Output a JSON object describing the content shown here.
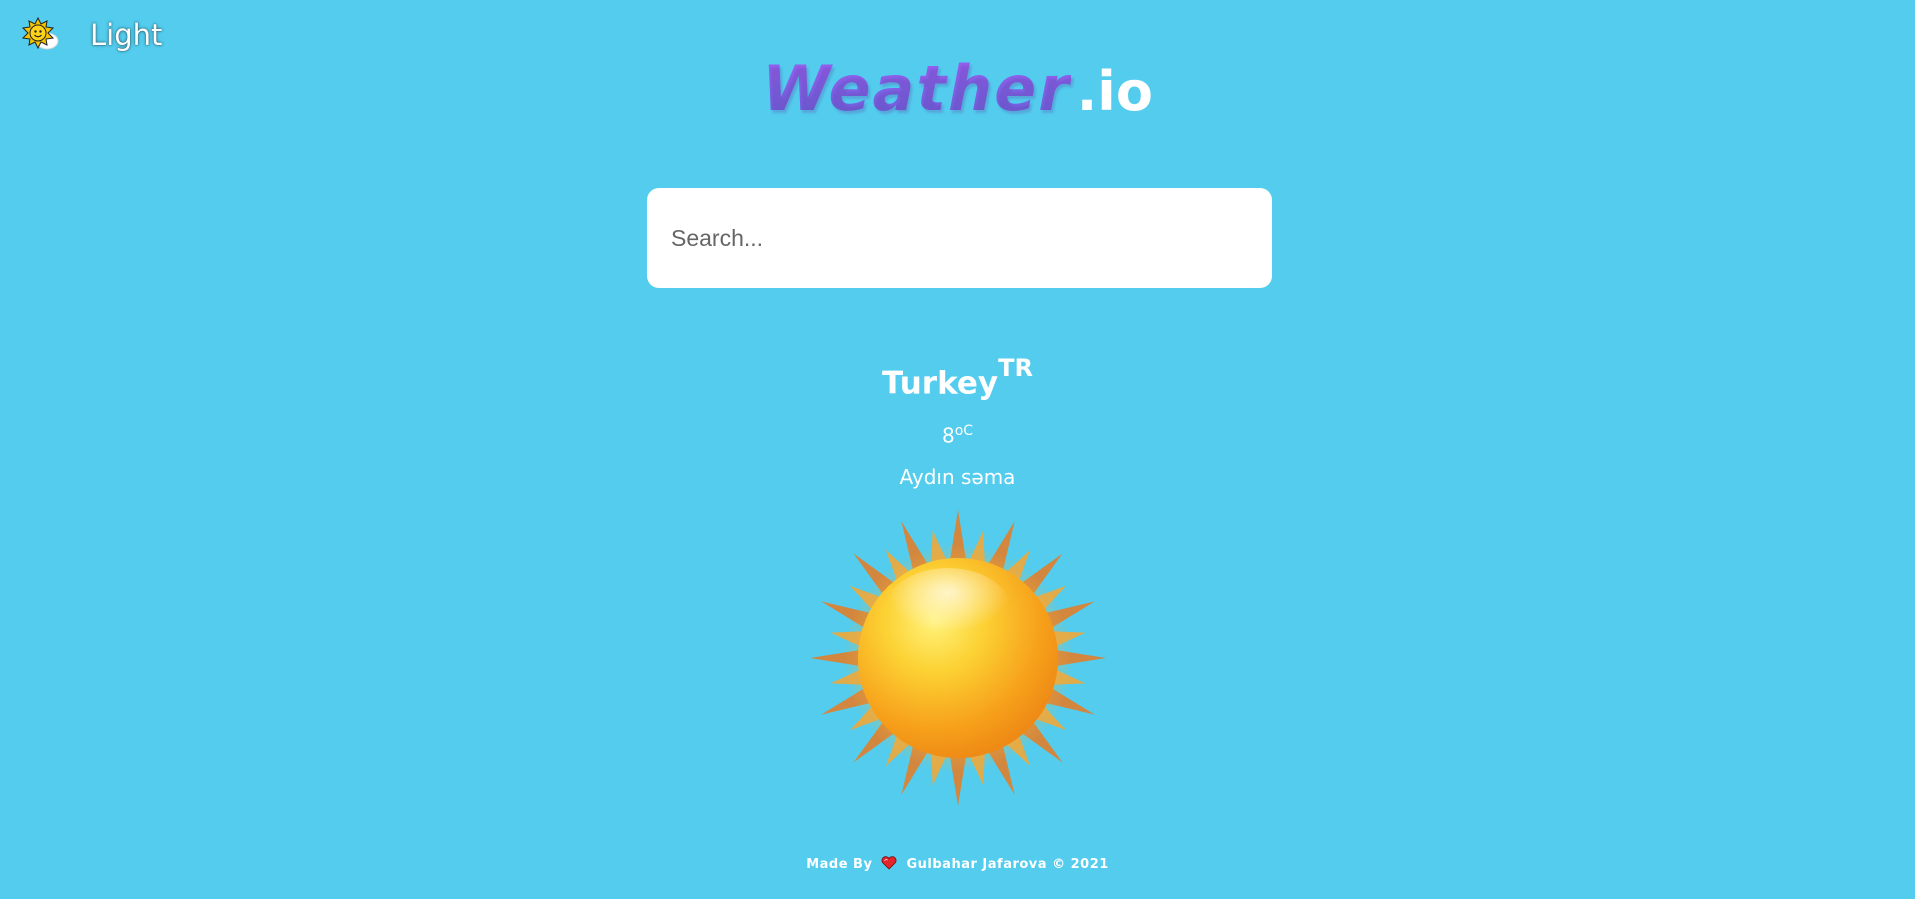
{
  "theme_toggle": {
    "label": "Light",
    "icon": "sun-cloud-icon"
  },
  "logo": {
    "main": "Weather",
    "suffix": ".io"
  },
  "search": {
    "placeholder": "Search...",
    "value": ""
  },
  "weather": {
    "city": "Turkey",
    "country_code": "TR",
    "temperature": "8",
    "unit": "oC",
    "description": "Aydın səma",
    "icon": "sun-icon"
  },
  "footer": {
    "prefix": "Made By",
    "heart_icon": "heart-icon",
    "author": "Gulbahar Jafarova © 2021"
  },
  "colors": {
    "background": "#53ccee",
    "logo_gradient_start": "#a15cf0",
    "logo_gradient_end": "#6b5fd8",
    "text": "#ffffff",
    "sun_core": "#fbb82a",
    "sun_rays": "#e98b2a"
  }
}
